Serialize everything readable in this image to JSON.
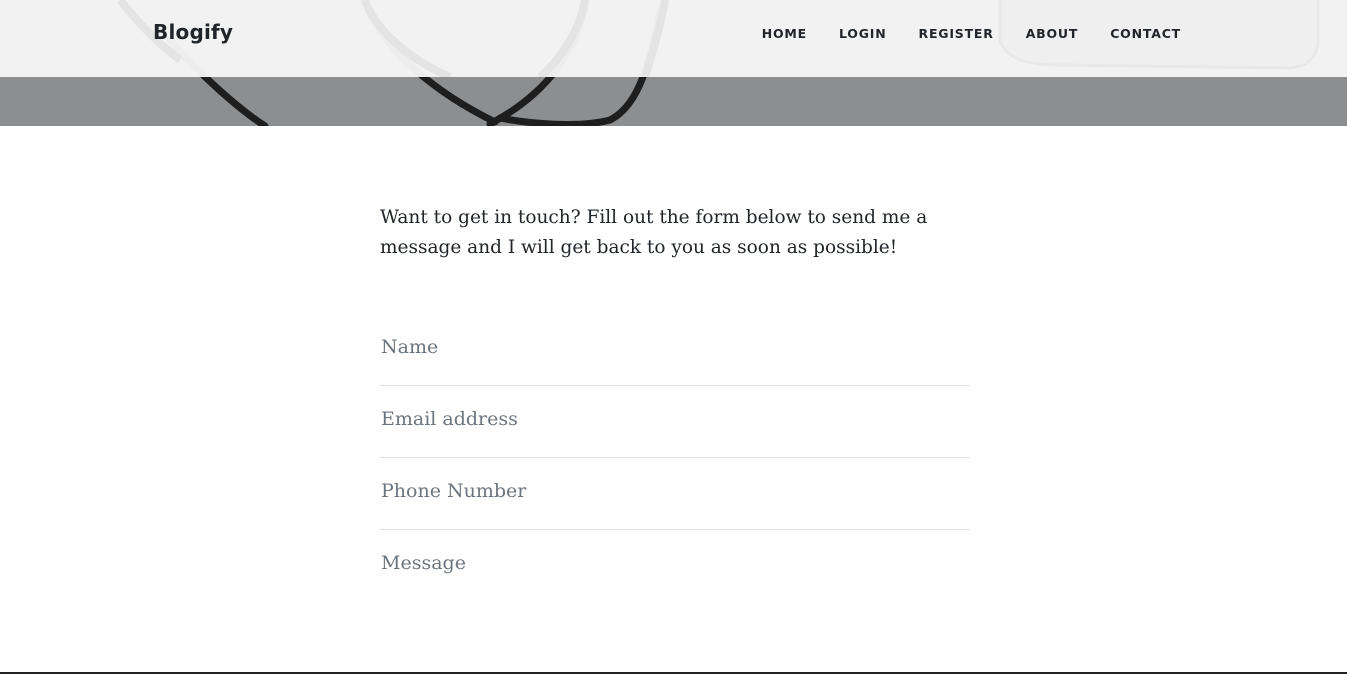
{
  "navbar": {
    "brand": "Blogify",
    "links": [
      {
        "label": "HOME"
      },
      {
        "label": "LOGIN"
      },
      {
        "label": "REGISTER"
      },
      {
        "label": "ABOUT"
      },
      {
        "label": "CONTACT"
      }
    ]
  },
  "main": {
    "intro": "Want to get in touch? Fill out the form below to send me a message and I will get back to you as soon as possible!",
    "form": {
      "name_placeholder": "Name",
      "email_placeholder": "Email address",
      "phone_placeholder": "Phone Number",
      "message_placeholder": "Message"
    }
  },
  "colors": {
    "text": "#212529",
    "placeholder": "#6c757d",
    "divider": "#dee2e6",
    "hero_overlay": "#8d8e90"
  }
}
